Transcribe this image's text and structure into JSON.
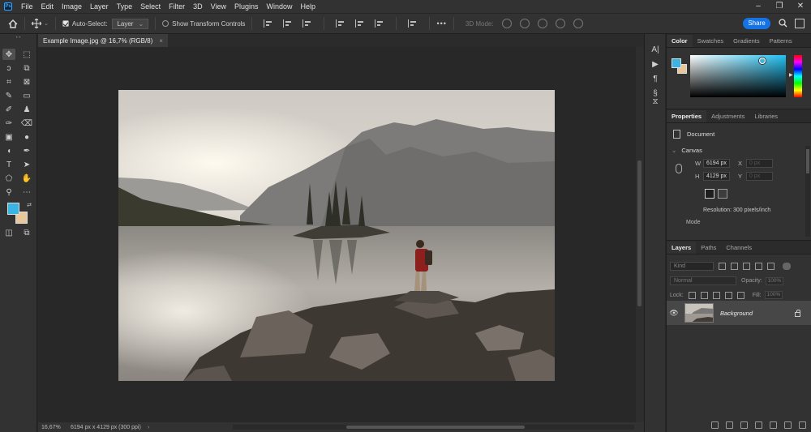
{
  "menubar": {
    "items": [
      "File",
      "Edit",
      "Image",
      "Layer",
      "Type",
      "Select",
      "Filter",
      "3D",
      "View",
      "Plugins",
      "Window",
      "Help"
    ]
  },
  "optionsbar": {
    "auto_select_label": "Auto-Select:",
    "auto_select_target": "Layer",
    "show_transform_label": "Show Transform Controls",
    "more_label": "•••",
    "mode_3d_label": "3D Mode:",
    "share_label": "Share"
  },
  "document_tab": {
    "title": "Example Image.jpg @ 16,7% (RGB/8)",
    "close_glyph": "×"
  },
  "statusbar": {
    "zoom": "16,67%",
    "info": "6194 px x 4129 px (300 ppi)",
    "arrow": "›"
  },
  "colors": {
    "foreground": "#3ab4e2",
    "background": "#e8c89a",
    "accent": "#1473e6"
  },
  "color_panel": {
    "tabs": [
      "Color",
      "Swatches",
      "Gradients",
      "Patterns"
    ]
  },
  "properties_panel": {
    "tabs": [
      "Properties",
      "Adjustments",
      "Libraries"
    ],
    "document_label": "Document",
    "section_label": "Canvas",
    "width_label": "W",
    "width_value": "6194 px",
    "height_label": "H",
    "height_value": "4129 px",
    "x_label": "X",
    "x_value": "0 px",
    "y_label": "Y",
    "y_value": "0 px",
    "resolution": "Resolution: 300 pixels/inch",
    "mode_label": "Mode"
  },
  "layers_panel": {
    "tabs": [
      "Layers",
      "Paths",
      "Channels"
    ],
    "kind_label": "Kind",
    "blend_mode": "Normal",
    "opacity_label": "Opacity:",
    "opacity_value": "100%",
    "lock_label": "Lock:",
    "fill_label": "Fill:",
    "fill_value": "100%",
    "layer_name": "Background"
  }
}
